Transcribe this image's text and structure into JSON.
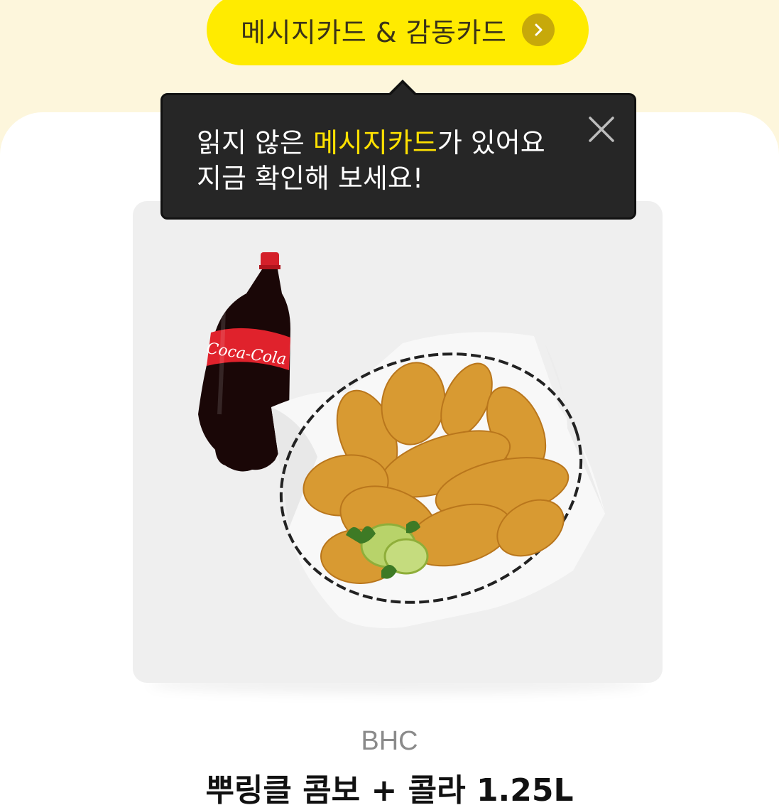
{
  "header": {
    "card_button_label": "메시지카드 & 감동카드",
    "card_button_icon": "chevron-right-icon"
  },
  "tooltip": {
    "line1_prefix": "읽지 않은 ",
    "line1_highlight": "메시지카드",
    "line1_suffix": "가 있어요",
    "line2": "지금 확인해 보세요!",
    "close_icon": "close-icon",
    "highlight_color": "#ffe100"
  },
  "product": {
    "image_alt": "BHC chicken basket with Coca-Cola bottle",
    "bottle_label": "Coca-Cola",
    "brand": "BHC",
    "title": "뿌링클 콤보 + 콜라 1.25L"
  },
  "colors": {
    "accent_yellow": "#ffeb00",
    "top_background": "#fdf6dc",
    "tooltip_background": "#262626"
  }
}
